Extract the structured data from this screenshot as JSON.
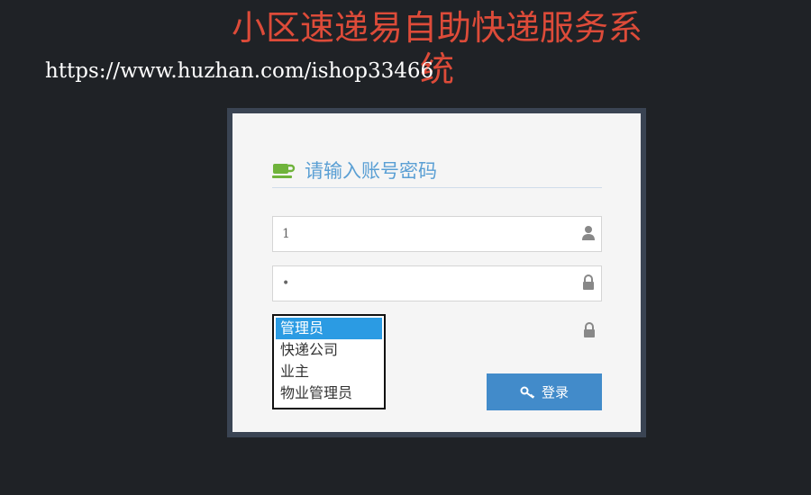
{
  "app_title": "小区速递易自助快递服务系统",
  "watermark_url": "https://www.huzhan.com/ishop33466",
  "login": {
    "header_text": "请输入账号密码",
    "username_value": "1",
    "password_value": "•",
    "role_options": [
      "管理员",
      "快递公司",
      "业主",
      "物业管理员"
    ],
    "selected_role": "管理员",
    "login_button_label": "登录"
  },
  "colors": {
    "title": "#dd4b39",
    "header_text": "#5a9fd4",
    "button": "#428bca",
    "selected_option": "#2b9be3",
    "coffee_icon": "#6fb33b"
  }
}
